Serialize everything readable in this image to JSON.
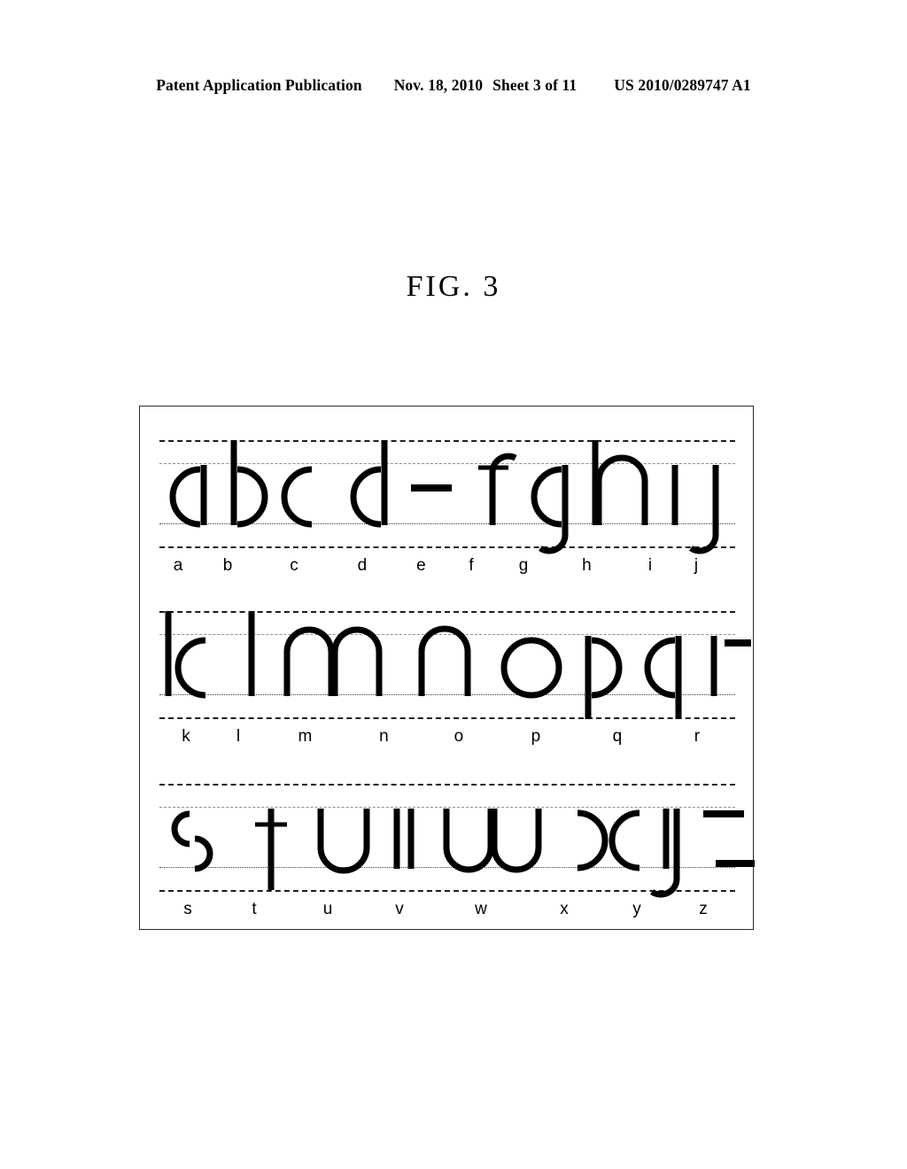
{
  "header": {
    "publication": "Patent Application Publication",
    "date": "Nov. 18, 2010",
    "sheet": "Sheet 3 of 11",
    "number": "US 2010/0289747 A1"
  },
  "figure": {
    "title": "FIG.  3",
    "caption_label": "FIG.",
    "caption_number": "3"
  },
  "diagram": {
    "description": "Handwriting stroke-decomposition chart of the lowercase Latin alphabet drawn on four-line ruled guides",
    "guide_lines": [
      "ascender-line",
      "x-height-line",
      "baseline",
      "descender-line"
    ],
    "rows": [
      {
        "row_index": 1,
        "labels": [
          "a",
          "b",
          "c",
          "d",
          "e",
          "f",
          "g",
          "h",
          "i",
          "j"
        ],
        "glyph_strokes": [
          {
            "letter": "a",
            "parts": [
              "c-arc",
              "short-vertical-right"
            ]
          },
          {
            "letter": "b",
            "parts": [
              "tall-vertical-left",
              "reverse-c-arc"
            ]
          },
          {
            "letter": "c",
            "parts": [
              "c-arc"
            ]
          },
          {
            "letter": "d",
            "parts": [
              "c-arc",
              "tall-vertical-right"
            ]
          },
          {
            "letter": "e",
            "parts": [
              "horizontal-bar"
            ]
          },
          {
            "letter": "f",
            "parts": [
              "tall-vertical-with-top-hook",
              "crossbar"
            ]
          },
          {
            "letter": "g",
            "parts": [
              "c-arc",
              "descender-hook-right"
            ]
          },
          {
            "letter": "h",
            "parts": [
              "tall-vertical-left",
              "n-arch"
            ]
          },
          {
            "letter": "i",
            "parts": [
              "short-vertical"
            ]
          },
          {
            "letter": "j",
            "parts": [
              "descender-hook-right"
            ]
          }
        ]
      },
      {
        "row_index": 2,
        "labels": [
          "k",
          "l",
          "m",
          "n",
          "o",
          "p",
          "q",
          "r"
        ],
        "glyph_strokes": [
          {
            "letter": "k",
            "parts": [
              "tall-vertical-left",
              "c-arc"
            ]
          },
          {
            "letter": "l",
            "parts": [
              "tall-vertical"
            ]
          },
          {
            "letter": "m",
            "parts": [
              "n-arch",
              "n-arch"
            ]
          },
          {
            "letter": "n",
            "parts": [
              "n-arch"
            ]
          },
          {
            "letter": "o",
            "parts": [
              "circle"
            ]
          },
          {
            "letter": "p",
            "parts": [
              "descender-vertical-left",
              "reverse-c-arc"
            ]
          },
          {
            "letter": "q",
            "parts": [
              "c-arc",
              "descender-vertical-right"
            ]
          },
          {
            "letter": "r",
            "parts": [
              "short-vertical",
              "short-horizontal-bar"
            ]
          }
        ]
      },
      {
        "row_index": 3,
        "labels": [
          "s",
          "t",
          "u",
          "v",
          "w",
          "x",
          "y",
          "z"
        ],
        "glyph_strokes": [
          {
            "letter": "s",
            "parts": [
              "small-c-arc-upper",
              "small-reverse-c-arc-lower"
            ]
          },
          {
            "letter": "t",
            "parts": [
              "descender-vertical",
              "crossbar"
            ]
          },
          {
            "letter": "u",
            "parts": [
              "u-curve"
            ]
          },
          {
            "letter": "v",
            "parts": [
              "short-vertical",
              "short-vertical"
            ]
          },
          {
            "letter": "w",
            "parts": [
              "u-curve",
              "u-curve"
            ]
          },
          {
            "letter": "x",
            "parts": [
              "reverse-c-arc",
              "c-arc"
            ]
          },
          {
            "letter": "y",
            "parts": [
              "short-vertical",
              "descender-hook-right"
            ]
          },
          {
            "letter": "z",
            "parts": [
              "upper-horizontal-bar",
              "lower-horizontal-bar"
            ]
          }
        ]
      }
    ]
  },
  "colors": {
    "ink": "#000000",
    "frame": "#2b2b2b",
    "guide_dark": "#1d1d1d",
    "guide_light": "#8e8e8e",
    "page": "#ffffff"
  }
}
